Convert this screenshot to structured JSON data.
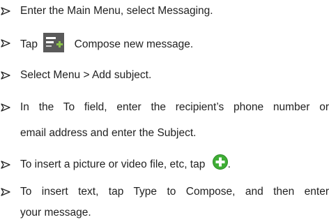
{
  "steps": [
    {
      "text": "Enter the Main Menu, select Messaging."
    },
    {
      "before": "Tap",
      "icon": "compose-message-icon",
      "after": "Compose new message."
    },
    {
      "text": "Select Menu > Add subject."
    },
    {
      "line1": "In the To field, enter the recipient’s phone number or",
      "line2": "email address and enter the Subject."
    },
    {
      "before": "To insert a picture or video file, etc, tap",
      "icon": "green-plus-icon",
      "after": "."
    },
    {
      "line1": "To insert text, tap Type to Compose, and then enter",
      "line2": "your message."
    }
  ],
  "colors": {
    "text": "#222222",
    "compose_icon_bg": "#5a5a5a",
    "compose_icon_plus": "#8bc34a",
    "plus_icon_green": "#3fae35"
  }
}
